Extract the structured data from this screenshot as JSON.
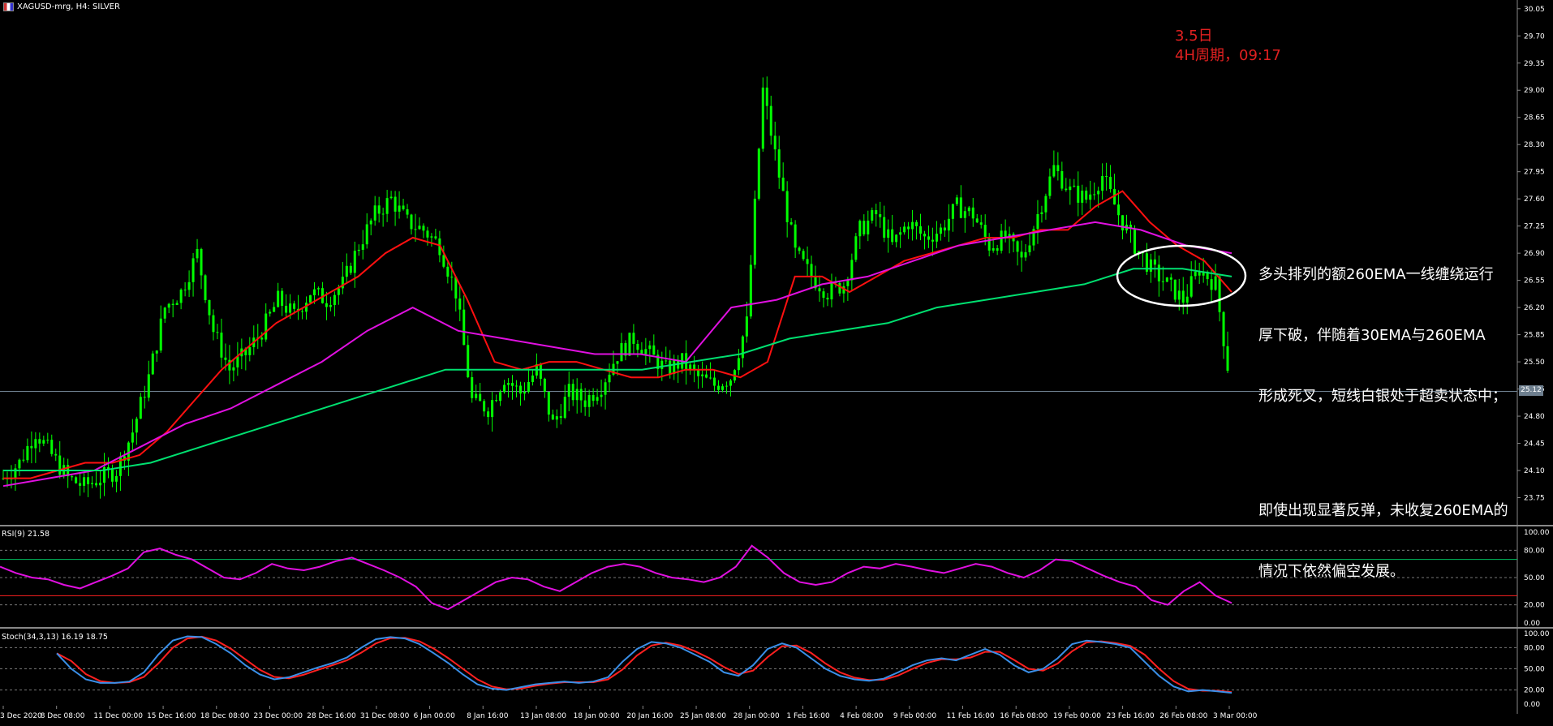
{
  "window": {
    "symbol_title": "XAGUSD-mrg, H4:  SILVER"
  },
  "notes": {
    "date": "3.5日",
    "period": "4H周期，09:17"
  },
  "annotation": {
    "line1": "多头排列的额260EMA一线缠绕运行",
    "line2": "厚下破，伴随着30EMA与260EMA",
    "line3": "形成死叉，短线白银处于超卖状态中；",
    "line4": "即使出现显著反弹，未收复260EMA的",
    "line5": "情况下依然偏空发展。"
  },
  "rsi_label": "RSI(9) 21.58",
  "stoch_label": "Stoch(34,3,13) 16.19 18.75",
  "current_price": "25.12",
  "colors": {
    "background": "#000000",
    "candles": "#00ff00",
    "ema30": "#ff1010",
    "ema_mid": "#e010e0",
    "ema260": "#00e070",
    "rsi": "#e010e0",
    "stoch_main": "#3a8fe8",
    "stoch_signal": "#ff2020",
    "annotation_circle": "#ffffff"
  },
  "chart_data": {
    "type": "line",
    "symbol": "XAGUSD-mrg",
    "timeframe": "H4",
    "x_labels": [
      "3 Dec 2020",
      "8 Dec 08:00",
      "11 Dec 00:00",
      "15 Dec 16:00",
      "18 Dec 08:00",
      "23 Dec 00:00",
      "28 Dec 16:00",
      "31 Dec 08:00",
      "6 Jan 00:00",
      "8 Jan 16:00",
      "13 Jan 08:00",
      "18 Jan 00:00",
      "20 Jan 16:00",
      "25 Jan 08:00",
      "28 Jan 00:00",
      "1 Feb 16:00",
      "4 Feb 08:00",
      "9 Feb 00:00",
      "11 Feb 16:00",
      "16 Feb 08:00",
      "19 Feb 00:00",
      "23 Feb 16:00",
      "26 Feb 08:00",
      "3 Mar 00:00"
    ],
    "y_ticks": [
      30.05,
      29.7,
      29.35,
      29.0,
      28.65,
      28.3,
      27.95,
      27.6,
      27.25,
      26.9,
      26.55,
      26.2,
      25.85,
      25.5,
      25.15,
      24.8,
      24.45,
      24.1,
      23.75
    ],
    "ylim": [
      23.4,
      30.1
    ],
    "current_price": 25.12,
    "series": [
      {
        "name": "",
        "kind": "close",
        "values": [
          24.0,
          24.2,
          24.6,
          24.3,
          24.0,
          23.9,
          24.0,
          24.1,
          24.6,
          25.3,
          26.2,
          26.4,
          26.9,
          25.9,
          25.4,
          25.6,
          25.9,
          26.3,
          26.1,
          26.4,
          26.3,
          26.5,
          27.0,
          27.4,
          27.6,
          27.3,
          27.2,
          27.0,
          26.4,
          25.0,
          24.9,
          25.3,
          25.1,
          25.4,
          24.7,
          25.1,
          25.0,
          25.2,
          25.6,
          25.8,
          25.6,
          25.4,
          25.5,
          25.3,
          25.2,
          25.3,
          26.0,
          29.0,
          27.9,
          26.9,
          26.6,
          26.4,
          26.5,
          27.2,
          27.4,
          27.0,
          27.3,
          27.1,
          27.2,
          27.5,
          27.4,
          27.0,
          27.1,
          26.8,
          27.4,
          28.0,
          27.7,
          27.6,
          27.9,
          27.4,
          27.0,
          26.7,
          26.5,
          26.3,
          26.7,
          26.5,
          25.1
        ]
      },
      {
        "name": "",
        "kind": "ema30",
        "values": [
          24.0,
          24.0,
          24.1,
          24.2,
          24.2,
          24.3,
          24.6,
          25.0,
          25.4,
          25.7,
          26.0,
          26.2,
          26.4,
          26.6,
          26.9,
          27.1,
          27.0,
          26.3,
          25.5,
          25.4,
          25.5,
          25.5,
          25.4,
          25.3,
          25.3,
          25.4,
          25.4,
          25.3,
          25.5,
          26.6,
          26.6,
          26.4,
          26.6,
          26.8,
          26.9,
          27.0,
          27.1,
          27.1,
          27.2,
          27.2,
          27.5,
          27.7,
          27.3,
          27.0,
          26.8,
          26.4
        ]
      },
      {
        "name": "",
        "kind": "ema_mid",
        "values": [
          23.9,
          24.0,
          24.1,
          24.4,
          24.7,
          24.9,
          25.2,
          25.5,
          25.9,
          26.2,
          25.9,
          25.8,
          25.7,
          25.6,
          25.6,
          25.5,
          26.2,
          26.3,
          26.5,
          26.6,
          26.8,
          27.0,
          27.1,
          27.2,
          27.3,
          27.2,
          27.0,
          26.9
        ]
      },
      {
        "name": "",
        "kind": "ema260",
        "values": [
          24.1,
          24.1,
          24.1,
          24.2,
          24.4,
          24.6,
          24.8,
          25.0,
          25.2,
          25.4,
          25.4,
          25.4,
          25.4,
          25.4,
          25.5,
          25.6,
          25.8,
          25.9,
          26.0,
          26.2,
          26.3,
          26.4,
          26.5,
          26.7,
          26.7,
          26.6
        ]
      }
    ],
    "rsi": {
      "period": 9,
      "value": 21.58,
      "levels": [
        70,
        30
      ],
      "ylim": [
        0,
        100
      ],
      "ticks": [
        100.0,
        80.0,
        50.0,
        20.0,
        0.0
      ],
      "values": [
        62,
        55,
        50,
        48,
        42,
        38,
        45,
        52,
        60,
        78,
        82,
        75,
        70,
        60,
        50,
        48,
        55,
        65,
        60,
        58,
        62,
        68,
        72,
        65,
        58,
        50,
        40,
        22,
        15,
        25,
        35,
        45,
        50,
        48,
        40,
        35,
        45,
        55,
        62,
        65,
        62,
        55,
        50,
        48,
        45,
        50,
        62,
        85,
        72,
        55,
        45,
        42,
        45,
        55,
        62,
        60,
        65,
        62,
        58,
        55,
        60,
        65,
        62,
        55,
        50,
        58,
        70,
        68,
        60,
        52,
        45,
        40,
        25,
        20,
        35,
        45,
        30,
        22
      ]
    },
    "stoch": {
      "params": "34,3,13",
      "main": 16.19,
      "signal": 18.75,
      "ylim": [
        0,
        100
      ],
      "ticks": [
        100.0,
        80.0,
        50.0,
        20.0,
        0.0
      ],
      "main_values": [
        72,
        50,
        35,
        30,
        30,
        32,
        45,
        70,
        90,
        96,
        95,
        85,
        72,
        55,
        42,
        35,
        38,
        45,
        52,
        58,
        66,
        80,
        92,
        95,
        93,
        85,
        72,
        58,
        42,
        28,
        22,
        20,
        24,
        28,
        30,
        32,
        30,
        32,
        38,
        60,
        78,
        88,
        86,
        80,
        70,
        60,
        45,
        40,
        55,
        78,
        86,
        80,
        65,
        50,
        40,
        35,
        33,
        36,
        45,
        55,
        62,
        65,
        62,
        70,
        78,
        70,
        55,
        45,
        50,
        65,
        85,
        90,
        88,
        85,
        80,
        60,
        40,
        25,
        18,
        20,
        18,
        16
      ]
    }
  }
}
